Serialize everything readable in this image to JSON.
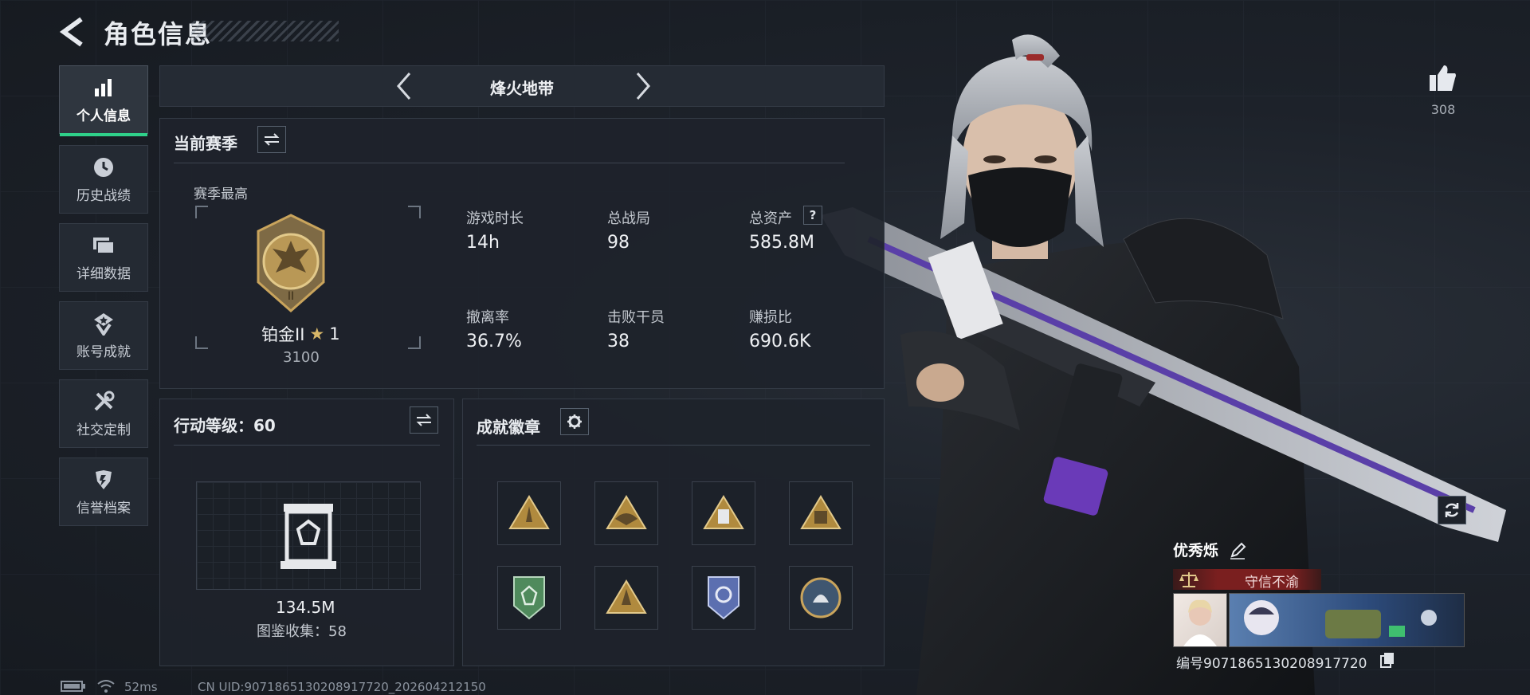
{
  "header": {
    "title": "角色信息"
  },
  "nav": [
    {
      "label": "个人信息",
      "icon": "bar-chart-icon",
      "active": true
    },
    {
      "label": "历史战绩",
      "icon": "clock-icon"
    },
    {
      "label": "详细数据",
      "icon": "folder-icon"
    },
    {
      "label": "账号成就",
      "icon": "medal-icon"
    },
    {
      "label": "社交定制",
      "icon": "tools-icon"
    },
    {
      "label": "信誉档案",
      "icon": "shield-icon"
    }
  ],
  "mode": {
    "name": "烽火地带"
  },
  "season": {
    "title": "当前赛季",
    "best_label": "赛季最高",
    "rank_name": "铂金II",
    "rank_stars": "1",
    "rank_score": "3100",
    "stats": [
      {
        "label": "游戏时长",
        "value": "14h"
      },
      {
        "label": "总战局",
        "value": "98"
      },
      {
        "label": "总资产",
        "value": "585.8M",
        "help": "?"
      },
      {
        "label": "撤离率",
        "value": "36.7%"
      },
      {
        "label": "击败干员",
        "value": "38"
      },
      {
        "label": "赚损比",
        "value": "690.6K"
      }
    ]
  },
  "action_level": {
    "title": "行动等级：60",
    "value": "134.5M",
    "collection": "图鉴收集：58"
  },
  "achievements": {
    "title": "成就徽章",
    "badge_count": 8,
    "badge_colors": [
      "#b08a3e",
      "#b08a3e",
      "#b08a3e",
      "#b08a3e",
      "#4f8a5c",
      "#b08a3e",
      "#5c6fb0",
      "#6c8aa8"
    ]
  },
  "likes": {
    "count": "308"
  },
  "player": {
    "name": "优秀烁",
    "credit_tag": "守信不渝",
    "id_label": "编号9071865130208917720"
  },
  "status": {
    "ping": "52ms",
    "uid": "CN UID:9071865130208917720_202604212150"
  },
  "colors": {
    "accent": "#2fd18a",
    "credit": "#7a1f1f",
    "gold": "#c9a45c"
  }
}
